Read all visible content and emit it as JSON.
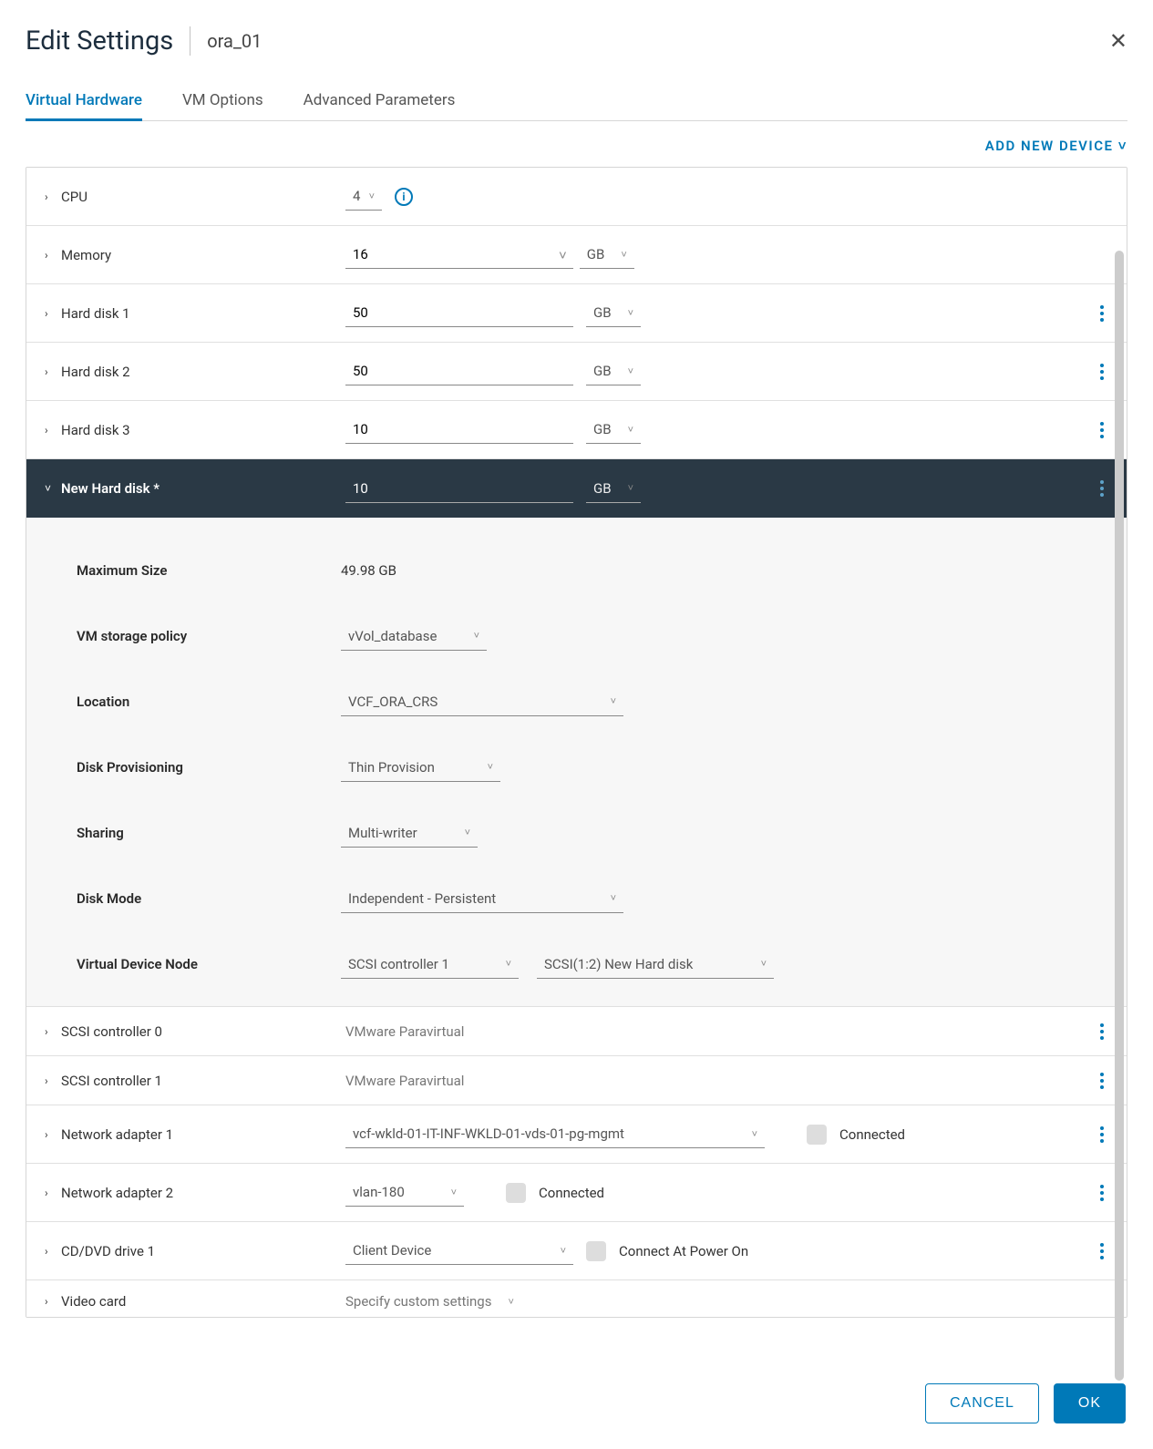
{
  "dialog": {
    "title": "Edit Settings",
    "vm_name": "ora_01",
    "tabs": [
      {
        "label": "Virtual Hardware"
      },
      {
        "label": "VM Options"
      },
      {
        "label": "Advanced Parameters"
      }
    ],
    "add_device_label": "ADD NEW DEVICE"
  },
  "hardware": {
    "cpu": {
      "label": "CPU",
      "value": "4"
    },
    "memory": {
      "label": "Memory",
      "value": "16",
      "unit": "GB"
    },
    "disk1": {
      "label": "Hard disk 1",
      "value": "50",
      "unit": "GB"
    },
    "disk2": {
      "label": "Hard disk 2",
      "value": "50",
      "unit": "GB"
    },
    "disk3": {
      "label": "Hard disk 3",
      "value": "10",
      "unit": "GB"
    },
    "new_disk": {
      "label": "New Hard disk *",
      "value": "10",
      "unit": "GB"
    },
    "scsi0": {
      "label": "SCSI controller 0",
      "desc": "VMware Paravirtual"
    },
    "scsi1": {
      "label": "SCSI controller 1",
      "desc": "VMware Paravirtual"
    },
    "nic1": {
      "label": "Network adapter 1",
      "network": "vcf-wkld-01-IT-INF-WKLD-01-vds-01-pg-mgmt",
      "connected_label": "Connected"
    },
    "nic2": {
      "label": "Network adapter 2",
      "network": "vlan-180",
      "connected_label": "Connected"
    },
    "cddvd": {
      "label": "CD/DVD drive 1",
      "device": "Client Device",
      "connect_label": "Connect At Power On"
    },
    "video": {
      "label": "Video card",
      "desc": "Specify custom settings"
    }
  },
  "new_disk_detail": {
    "max_size": {
      "label": "Maximum Size",
      "value": "49.98 GB"
    },
    "policy": {
      "label": "VM storage policy",
      "value": "vVol_database"
    },
    "location": {
      "label": "Location",
      "value": "VCF_ORA_CRS"
    },
    "provisioning": {
      "label": "Disk Provisioning",
      "value": "Thin Provision"
    },
    "sharing": {
      "label": "Sharing",
      "value": "Multi-writer"
    },
    "disk_mode": {
      "label": "Disk Mode",
      "value": "Independent - Persistent"
    },
    "vdn": {
      "label": "Virtual Device Node",
      "controller": "SCSI controller 1",
      "slot": "SCSI(1:2) New Hard disk"
    }
  },
  "footer": {
    "cancel": "CANCEL",
    "ok": "OK"
  }
}
